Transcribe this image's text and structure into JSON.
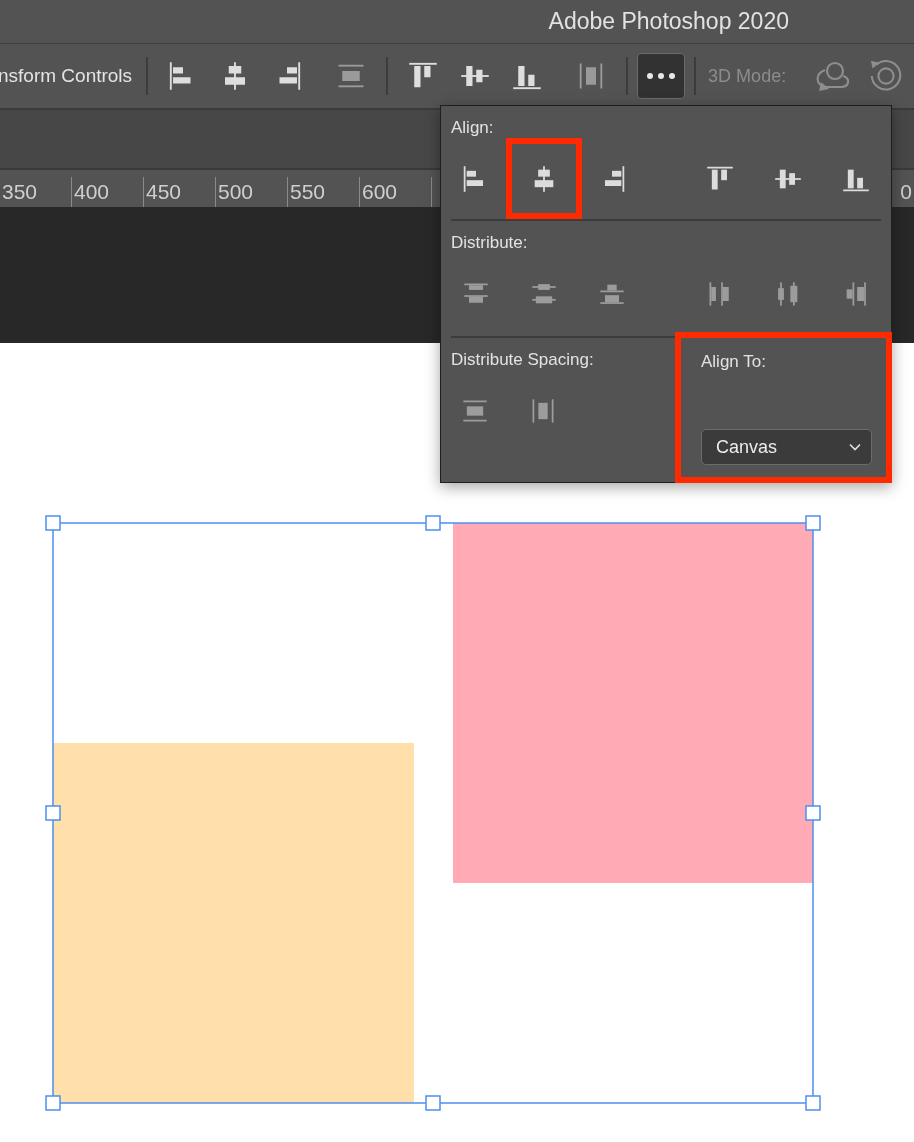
{
  "window": {
    "title": "Adobe Photoshop 2020"
  },
  "options_bar": {
    "label": "nsform Controls",
    "groups": [
      {
        "buttons": [
          {
            "kind": "align-left",
            "disabled": false
          },
          {
            "kind": "align-hcenter",
            "disabled": false
          },
          {
            "kind": "align-right",
            "disabled": false
          },
          {
            "kind": "space-v",
            "disabled": true
          }
        ]
      },
      {
        "buttons": [
          {
            "kind": "align-top",
            "disabled": false
          },
          {
            "kind": "align-vcenter",
            "disabled": false
          },
          {
            "kind": "align-bottom",
            "disabled": false
          },
          {
            "kind": "space-h",
            "disabled": true
          }
        ]
      }
    ],
    "more_button": {
      "selected": true
    },
    "mode_label": {
      "text": "3D Mode:",
      "disabled": true
    },
    "mode_tools": [
      {
        "kind": "orbit"
      },
      {
        "kind": "rotate"
      }
    ]
  },
  "ruler": {
    "labels": [
      "350",
      "400",
      "450",
      "500",
      "550",
      "600",
      "0"
    ]
  },
  "popup": {
    "align": {
      "label": "Align:",
      "buttons": [
        {
          "kind": "align-left",
          "highlighted": false
        },
        {
          "kind": "align-hcenter",
          "highlighted": true
        },
        {
          "kind": "align-right",
          "highlighted": false
        },
        {
          "kind": "align-top",
          "highlighted": false
        },
        {
          "kind": "align-vcenter",
          "highlighted": false
        },
        {
          "kind": "align-bottom",
          "highlighted": false
        }
      ]
    },
    "distribute": {
      "label": "Distribute:",
      "buttons": [
        {
          "kind": "dist-top",
          "disabled": true
        },
        {
          "kind": "dist-vcenter",
          "disabled": true
        },
        {
          "kind": "dist-bottom",
          "disabled": true
        },
        {
          "kind": "dist-left",
          "disabled": true
        },
        {
          "kind": "dist-hcenter",
          "disabled": true
        },
        {
          "kind": "dist-right",
          "disabled": true
        }
      ]
    },
    "distribute_spacing": {
      "label": "Distribute Spacing:",
      "buttons": [
        {
          "kind": "space-v",
          "disabled": true
        },
        {
          "kind": "space-h",
          "disabled": true
        }
      ]
    },
    "align_to": {
      "label": "Align To:",
      "highlighted": true,
      "select": {
        "value": "Canvas"
      }
    }
  },
  "canvas": {
    "layers": [
      {
        "color": "#ffaab5"
      },
      {
        "color": "#ffdfaa"
      }
    ]
  }
}
